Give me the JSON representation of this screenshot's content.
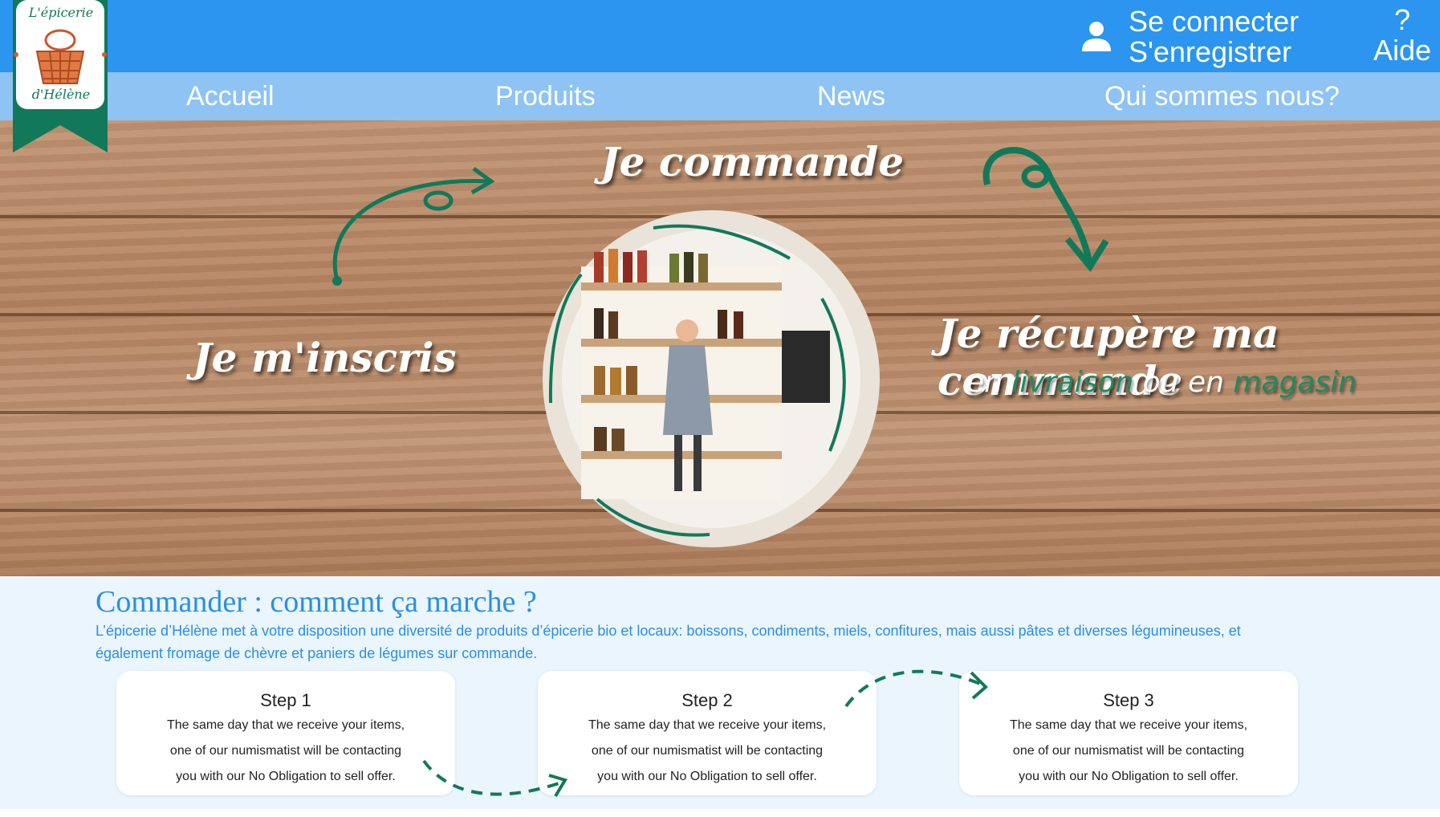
{
  "header": {
    "login_label": "Se connecter",
    "register_label": "S'enregistrer",
    "help_mark": "?",
    "help_label": "Aide",
    "user_icon": "user-icon"
  },
  "logo": {
    "line1": "L'épicerie",
    "line2": "d'Hélène",
    "icon": "basket-icon"
  },
  "nav": {
    "items": [
      "Accueil",
      "Produits",
      "News",
      "Qui sommes nous?"
    ]
  },
  "hero": {
    "commande": "Je  commande",
    "inscris": "Je m'inscris",
    "recupere": "Je récupère ma commande",
    "sub_en1": "en",
    "sub_livraison": "livraison",
    "sub_ou_en": "ou en",
    "sub_magasin": "magasin",
    "colors": {
      "green": "#1f8a62",
      "wood": "#b58461"
    }
  },
  "howto": {
    "title": "Commander : comment ça marche ?",
    "description": "L’épicerie d’Hélène met à votre disposition une diversité de produits d’épicerie bio et locaux: boissons, condiments, miels, confitures, mais aussi pâtes et diverses légumineuses, et également fromage de chèvre et paniers de légumes sur commande.",
    "steps": [
      {
        "title": "Step 1",
        "l1": "The same day that we receive your items,",
        "l2": "one of our numismatist will be contacting",
        "l3": "you with our No Obligation to sell offer."
      },
      {
        "title": "Step 2",
        "l1": "The same day that we receive your items,",
        "l2": "one of our numismatist will be contacting",
        "l3": "you with our No Obligation to sell offer."
      },
      {
        "title": "Step 3",
        "l1": "The same day that we receive your items,",
        "l2": "one of our numismatist will be contacting",
        "l3": "you with our No Obligation to sell offer."
      }
    ]
  },
  "colors": {
    "topbar": "#2b95f0",
    "navbar": "#8ec3f3",
    "accent_text": "#2b8fe0",
    "section_bg": "#eaf5fd"
  }
}
